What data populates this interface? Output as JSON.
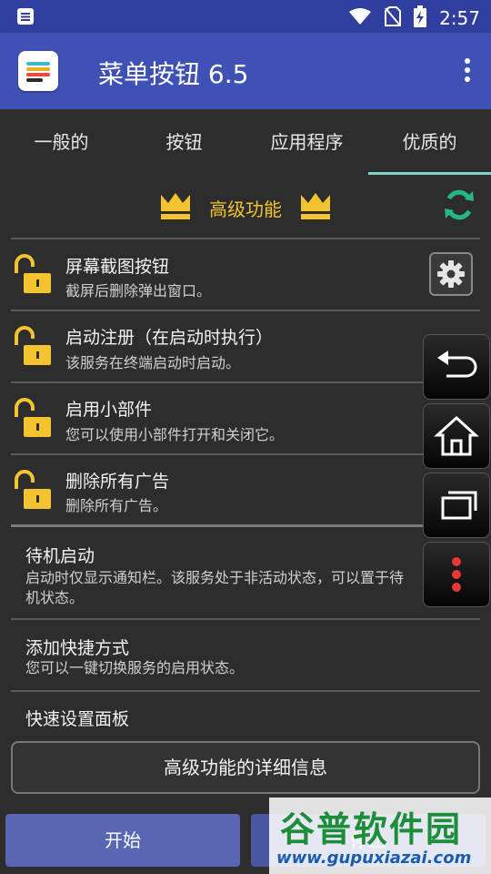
{
  "status_bar": {
    "time": "2:57",
    "icons": [
      "notification-icon",
      "wifi-icon",
      "no-sim-icon",
      "battery-charging-icon"
    ]
  },
  "app_bar": {
    "title": "菜单按钮 6.5",
    "icon": "app-logo-icon",
    "menu_icon": "overflow-menu-icon"
  },
  "tabs": [
    {
      "label": "一般的"
    },
    {
      "label": "按钮"
    },
    {
      "label": "应用程序"
    },
    {
      "label": "优质的",
      "active": true
    }
  ],
  "premium": {
    "title": "高级功能",
    "accent_color": "#f4c430",
    "refresh_color": "#26b58a"
  },
  "locked_features": [
    {
      "title": "屏幕截图按钮",
      "subtitle": "截屏后删除弹出窗口。"
    },
    {
      "title": "启动注册（在启动时执行）",
      "subtitle": "该服务在终端启动时启动。"
    },
    {
      "title": "启用小部件",
      "subtitle": "您可以使用小部件打开和关闭它。"
    },
    {
      "title": "删除所有广告",
      "subtitle": "删除所有广告。"
    }
  ],
  "settings": [
    {
      "title": "待机启动",
      "subtitle": "启动时仅显示通知栏。该服务处于非活动状态，可以置于待机状态。"
    },
    {
      "title": "添加快捷方式",
      "subtitle": "您可以一键切换服务的启用状态。"
    },
    {
      "title": "快速设置面板"
    }
  ],
  "floating_buttons": [
    "back-icon",
    "home-icon",
    "recents-icon",
    "menu-dots-icon"
  ],
  "details_button": "高级功能的详细信息",
  "bottom": {
    "start_label": "开始",
    "stop_label": "停止",
    "start_color": "#5966b4"
  },
  "watermark": {
    "title": "谷普软件园",
    "url": "www.gupuxiazai.com"
  }
}
